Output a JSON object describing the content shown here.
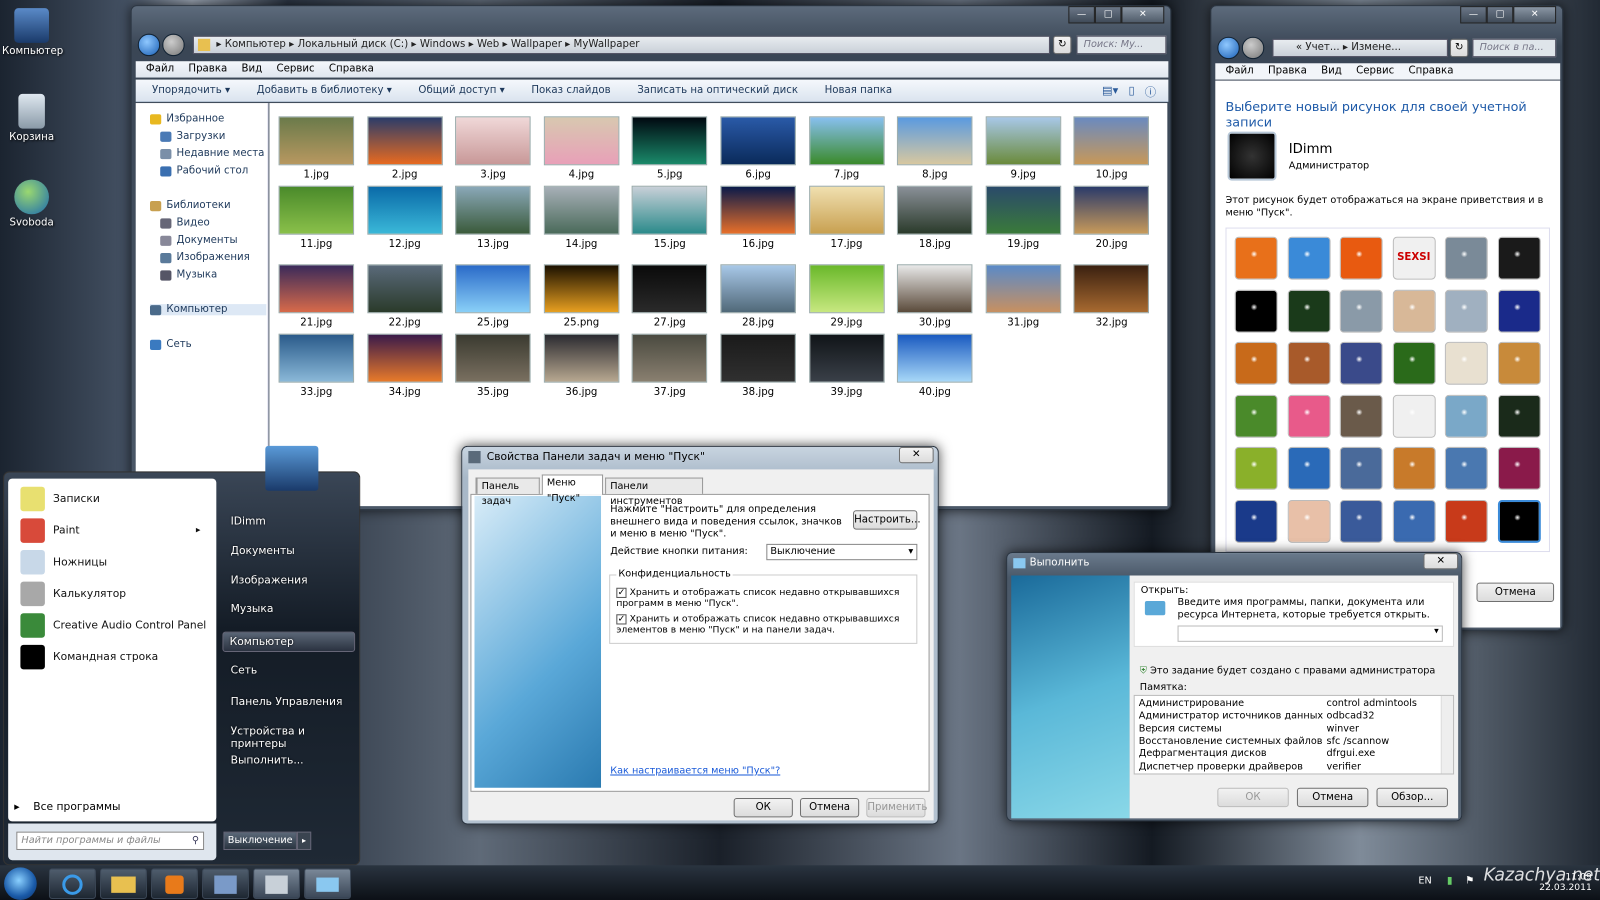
{
  "desktop": {
    "icons": [
      {
        "label": "Компьютер",
        "icon": "computer-icon"
      },
      {
        "label": "Корзина",
        "icon": "recycle-bin-icon"
      },
      {
        "label": "Svoboda",
        "icon": "globe-icon"
      }
    ]
  },
  "explorer": {
    "breadcrumb": [
      "Компьютер",
      "Локальный диск (C:)",
      "Windows",
      "Web",
      "Wallpaper",
      "MyWallpaper"
    ],
    "search_placeholder": "Поиск: My...",
    "menu": [
      "Файл",
      "Правка",
      "Вид",
      "Сервис",
      "Справка"
    ],
    "toolbar": [
      "Упорядочить ▾",
      "Добавить в библиотеку ▾",
      "Общий доступ ▾",
      "Показ слайдов",
      "Записать на оптический диск",
      "Новая папка"
    ],
    "nav": [
      {
        "label": "Избранное",
        "group": true,
        "color": "#e8b820"
      },
      {
        "label": "Загрузки",
        "color": "#4a7ab5"
      },
      {
        "label": "Недавние места",
        "color": "#7a8fa8"
      },
      {
        "label": "Рабочий стол",
        "color": "#3a6fb0"
      },
      {
        "label": "Библиотеки",
        "group": true,
        "color": "#c8a050"
      },
      {
        "label": "Видео",
        "color": "#667"
      },
      {
        "label": "Документы",
        "color": "#889"
      },
      {
        "label": "Изображения",
        "color": "#5a7a9a"
      },
      {
        "label": "Музыка",
        "color": "#556"
      },
      {
        "label": "Компьютер",
        "group": true,
        "color": "#4a6a8a",
        "selected": true
      },
      {
        "label": "Сеть",
        "group": true,
        "color": "#3a7ac0"
      }
    ],
    "files": [
      {
        "name": "1.jpg",
        "colors": [
          "#6a7a4a",
          "#b89860"
        ]
      },
      {
        "name": "2.jpg",
        "colors": [
          "#2a3c6a",
          "#e86a20"
        ]
      },
      {
        "name": "3.jpg",
        "colors": [
          "#f0d8d8",
          "#c89898"
        ]
      },
      {
        "name": "4.jpg",
        "colors": [
          "#d8c8b0",
          "#e8a0b8"
        ]
      },
      {
        "name": "5.jpg",
        "colors": [
          "#000810",
          "#1a8a6a"
        ]
      },
      {
        "name": "6.jpg",
        "colors": [
          "#2a5aa8",
          "#0a2a5a"
        ]
      },
      {
        "name": "7.jpg",
        "colors": [
          "#88c0f0",
          "#3a8a2a"
        ]
      },
      {
        "name": "8.jpg",
        "colors": [
          "#5a9ae0",
          "#d8c8a0"
        ]
      },
      {
        "name": "9.jpg",
        "colors": [
          "#a8c8e8",
          "#6a8a3a"
        ]
      },
      {
        "name": "10.jpg",
        "colors": [
          "#6a8ac0",
          "#c89858"
        ]
      },
      {
        "name": "11.jpg",
        "colors": [
          "#4a8a2a",
          "#8ac04a"
        ]
      },
      {
        "name": "12.jpg",
        "colors": [
          "#0a6aa8",
          "#3ab8d8"
        ]
      },
      {
        "name": "13.jpg",
        "colors": [
          "#8aa8b8",
          "#3a5a3a"
        ]
      },
      {
        "name": "14.jpg",
        "colors": [
          "#a8b0b8",
          "#4a6a5a"
        ]
      },
      {
        "name": "15.jpg",
        "colors": [
          "#c8d0d8",
          "#2a8a8a"
        ]
      },
      {
        "name": "16.jpg",
        "colors": [
          "#0a1a4a",
          "#e8702a"
        ]
      },
      {
        "name": "17.jpg",
        "colors": [
          "#f0e0b0",
          "#c8a050"
        ]
      },
      {
        "name": "18.jpg",
        "colors": [
          "#8a9098",
          "#2a3a2a"
        ]
      },
      {
        "name": "19.jpg",
        "colors": [
          "#2a4a6a",
          "#3a7a3a"
        ]
      },
      {
        "name": "20.jpg",
        "colors": [
          "#2a3a6a",
          "#c89a5a"
        ]
      },
      {
        "name": "21.jpg",
        "colors": [
          "#3a2a5a",
          "#d86a4a"
        ]
      },
      {
        "name": "22.jpg",
        "colors": [
          "#5a6a7a",
          "#2a3a2a"
        ]
      },
      {
        "name": "25.jpg",
        "colors": [
          "#2a6ac8",
          "#8ad0f8"
        ]
      },
      {
        "name": "25.png",
        "colors": [
          "#1a1000",
          "#e8a020"
        ]
      },
      {
        "name": "27.jpg",
        "colors": [
          "#0a0a0a",
          "#2a2a2a"
        ]
      },
      {
        "name": "28.jpg",
        "colors": [
          "#a8c8e8",
          "#506878"
        ]
      },
      {
        "name": "29.jpg",
        "colors": [
          "#6ab82a",
          "#c8e880"
        ]
      },
      {
        "name": "30.jpg",
        "colors": [
          "#e8e8e8",
          "#5a4a3a"
        ]
      },
      {
        "name": "31.jpg",
        "colors": [
          "#5a8ac8",
          "#c89060"
        ]
      },
      {
        "name": "32.jpg",
        "colors": [
          "#3a2010",
          "#a86a30"
        ]
      },
      {
        "name": "33.jpg",
        "colors": [
          "#2a5a8a",
          "#8ab8d8"
        ]
      },
      {
        "name": "34.jpg",
        "colors": [
          "#3a1a4a",
          "#e87a2a"
        ]
      },
      {
        "name": "35.jpg",
        "colors": [
          "#3a3a30",
          "#7a7060"
        ]
      },
      {
        "name": "36.jpg",
        "colors": [
          "#2a2a30",
          "#b8a890"
        ]
      },
      {
        "name": "37.jpg",
        "colors": [
          "#4a4a40",
          "#8a8070"
        ]
      },
      {
        "name": "38.jpg",
        "colors": [
          "#1a1a1a",
          "#303030"
        ]
      },
      {
        "name": "39.jpg",
        "colors": [
          "#101418",
          "#3a4048"
        ]
      },
      {
        "name": "40.jpg",
        "colors": [
          "#1a5ac0",
          "#a8d8f8"
        ]
      }
    ]
  },
  "account": {
    "breadcrumb": [
      "« Учет...",
      "Измене..."
    ],
    "search_placeholder": "Поиск в па...",
    "menu": [
      "Файл",
      "Правка",
      "Вид",
      "Сервис",
      "Справка"
    ],
    "heading": "Выберите новый рисунок для своей учетной записи",
    "user_name": "IDimm",
    "user_role": "Администратор",
    "description": "Этот рисунок будет отображаться на экране приветствия и в меню \"Пуск\".",
    "sexsi_label": "SEXSI",
    "cancel": "Отмена",
    "avatars": [
      "#e8701a",
      "#3a8ad8",
      "#e85a10",
      "#f0f0f0",
      "#7a8a98",
      "#1a1a1a",
      "#000000",
      "#1a3a1a",
      "#8a9aa8",
      "#d8b898",
      "#a0b0c0",
      "#1a2a8a",
      "#c86a1a",
      "#a85a2a",
      "#3a4a8a",
      "#2a6a1a",
      "#e8e0d0",
      "#c88a3a",
      "#4a8a2a",
      "#e85a8a",
      "#6a5a4a",
      "#f0f0f0",
      "#7aa8c8",
      "#1a2a1a",
      "#8ab02a",
      "#2a6ab8",
      "#4a6a9a",
      "#c87a2a",
      "#4a78b0",
      "#8a1a4a",
      "#1a3a8a",
      "#e8c0a8",
      "#3a5a9a",
      "#3a6ab0",
      "#c83a1a",
      "#000000"
    ]
  },
  "taskbar_props": {
    "title": "Свойства Панели задач и меню \"Пуск\"",
    "tabs": [
      "Панель задач",
      "Меню \"Пуск\"",
      "Панели инструментов"
    ],
    "active_tab": 1,
    "customize_text": "Нажмите \"Настроить\" для определения внешнего вида и поведения ссылок, значков и меню в меню \"Пуск\".",
    "customize_button": "Настроить...",
    "power_label": "Действие кнопки питания:",
    "power_value": "Выключение",
    "privacy_label": "Конфиденциальность",
    "check1": "Хранить и отображать список недавно открывавшихся программ в меню \"Пуск\".",
    "check2": "Хранить и отображать список недавно открывавшихся элементов в меню \"Пуск\" и на панели задач.",
    "check1_checked": true,
    "check2_checked": true,
    "help_link": "Как настраивается меню \"Пуск\"?",
    "ok": "ОК",
    "cancel": "Отмена",
    "apply": "Применить"
  },
  "run": {
    "title": "Выполнить",
    "open_label": "Открыть:",
    "description": "Введите имя программы, папки, документа или ресурса Интернета, которые требуется открыть.",
    "input_value": "",
    "admin_note": "Это задание будет создано с правами администратора",
    "memo_label": "Памятка:",
    "memo": [
      [
        "Администрирование",
        "control admintools"
      ],
      [
        "Администратор источников данных",
        "odbcad32"
      ],
      [
        "Версия системы",
        "winver"
      ],
      [
        "Восстановление системных файлов",
        "sfc /scannow"
      ],
      [
        "Дефрагментация дисков",
        "dfrgui.exe"
      ],
      [
        "Диспетчер проверки драйверов",
        "verifier"
      ]
    ],
    "ok": "ОК",
    "cancel": "Отмена",
    "browse": "Обзор..."
  },
  "start_menu": {
    "programs": [
      {
        "label": "Записки",
        "color": "#e8e070",
        "arrow": false
      },
      {
        "label": "Paint",
        "color": "#d84a3a",
        "arrow": true
      },
      {
        "label": "Ножницы",
        "color": "#c8d8e8",
        "arrow": false
      },
      {
        "label": "Калькулятор",
        "color": "#a8a8a8",
        "arrow": false
      },
      {
        "label": "Creative Audio Control Panel",
        "color": "#3a8a3a",
        "arrow": false
      },
      {
        "label": "Командная строка",
        "color": "#000000",
        "arrow": false
      }
    ],
    "all_programs": "Все программы",
    "search_placeholder": "Найти программы и файлы",
    "right": [
      "IDimm",
      "Документы",
      "Изображения",
      "Музыка",
      "Компьютер",
      "Сеть",
      "Панель  Управления",
      "Устройства и принтеры",
      "Выполнить..."
    ],
    "right_selected": 4,
    "shutdown": "Выключение"
  },
  "taskbar": {
    "items": [
      "start-orb",
      "internet-explorer",
      "explorer",
      "media-player",
      "control-panel",
      "taskbar-properties",
      "run"
    ],
    "language": "EN",
    "time": "11:09",
    "date": "22.03.2011",
    "watermark": "Kazachya.net"
  }
}
